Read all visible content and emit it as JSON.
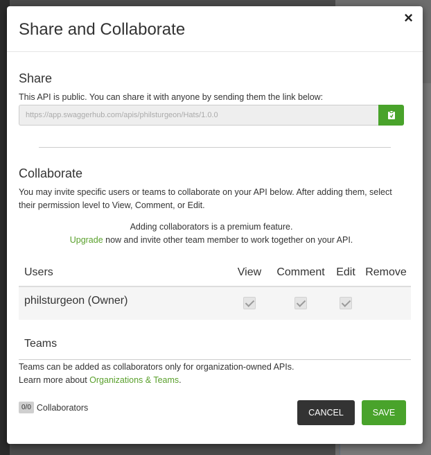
{
  "modal": {
    "title": "Share and Collaborate",
    "close_label": "×"
  },
  "share": {
    "heading": "Share",
    "description": "This API is public. You can share it with anyone by sending them the link below:",
    "link_value": "https://app.swaggerhub.com/apis/philsturgeon/Hats/1.0.0"
  },
  "collaborate": {
    "heading": "Collaborate",
    "description": "You may invite specific users or teams to collaborate on your API below. After adding them, select their permission level to View, Comment, or Edit.",
    "premium_line1": "Adding collaborators is a premium feature.",
    "upgrade_link": "Upgrade",
    "premium_line2": " now and invite other team member to work together on your API."
  },
  "users_table": {
    "headers": [
      "Users",
      "View",
      "Comment",
      "Edit",
      "Remove"
    ],
    "rows": [
      {
        "name": "philsturgeon (Owner)",
        "view": true,
        "comment": true,
        "edit": true
      }
    ]
  },
  "teams": {
    "heading": "Teams",
    "note_line1": "Teams can be added as collaborators only for organization-owned APIs.",
    "learn_prefix": "Learn more about ",
    "learn_link": "Organizations & Teams",
    "learn_suffix": "."
  },
  "footer": {
    "count_badge": "0/0",
    "count_label": "Collaborators",
    "cancel_label": "CANCEL",
    "save_label": "SAVE"
  },
  "colors": {
    "accent_green": "#49a32b",
    "link_green": "#5aa02c",
    "cancel_dark": "#333333"
  },
  "icons": {
    "copy": "clipboard-icon",
    "close": "close-icon",
    "checkbox": "checkbox-checked-disabled"
  }
}
